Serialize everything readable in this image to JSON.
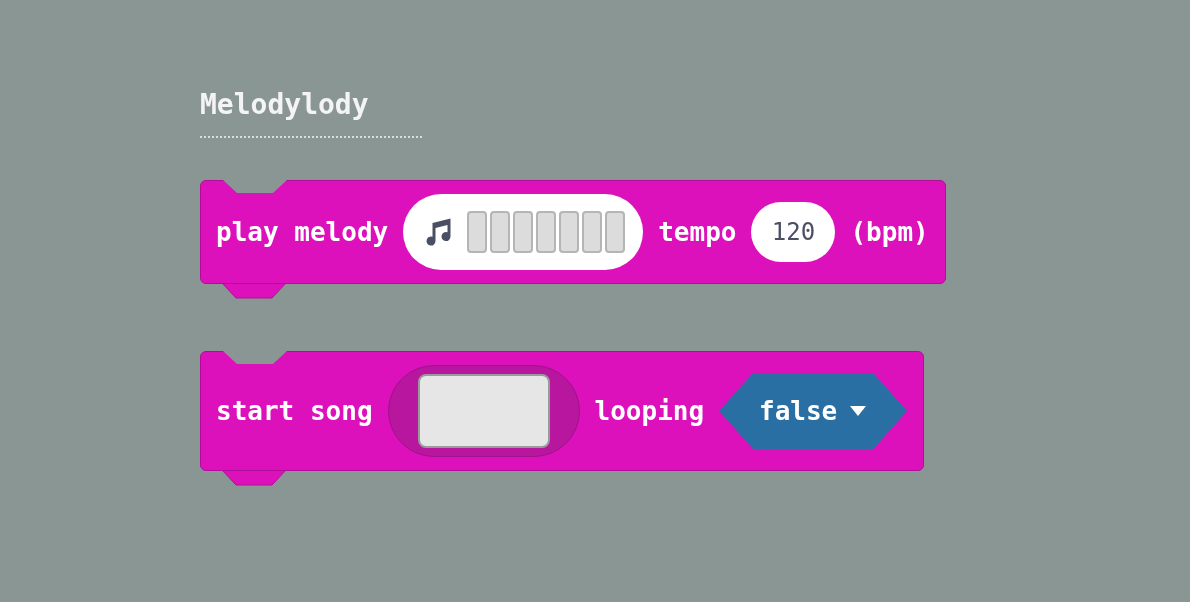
{
  "heading": "Melodylody",
  "blocks": [
    {
      "items": [
        {
          "kind": "text",
          "text": "play melody"
        },
        {
          "kind": "melody"
        },
        {
          "kind": "text",
          "text": "tempo"
        },
        {
          "kind": "number",
          "text": "120"
        },
        {
          "kind": "text",
          "text": "(bpm)"
        }
      ]
    },
    {
      "items": [
        {
          "kind": "text",
          "text": "start song"
        },
        {
          "kind": "slot"
        },
        {
          "kind": "text",
          "text": "looping"
        },
        {
          "kind": "dropdown",
          "text": "false"
        }
      ]
    }
  ]
}
